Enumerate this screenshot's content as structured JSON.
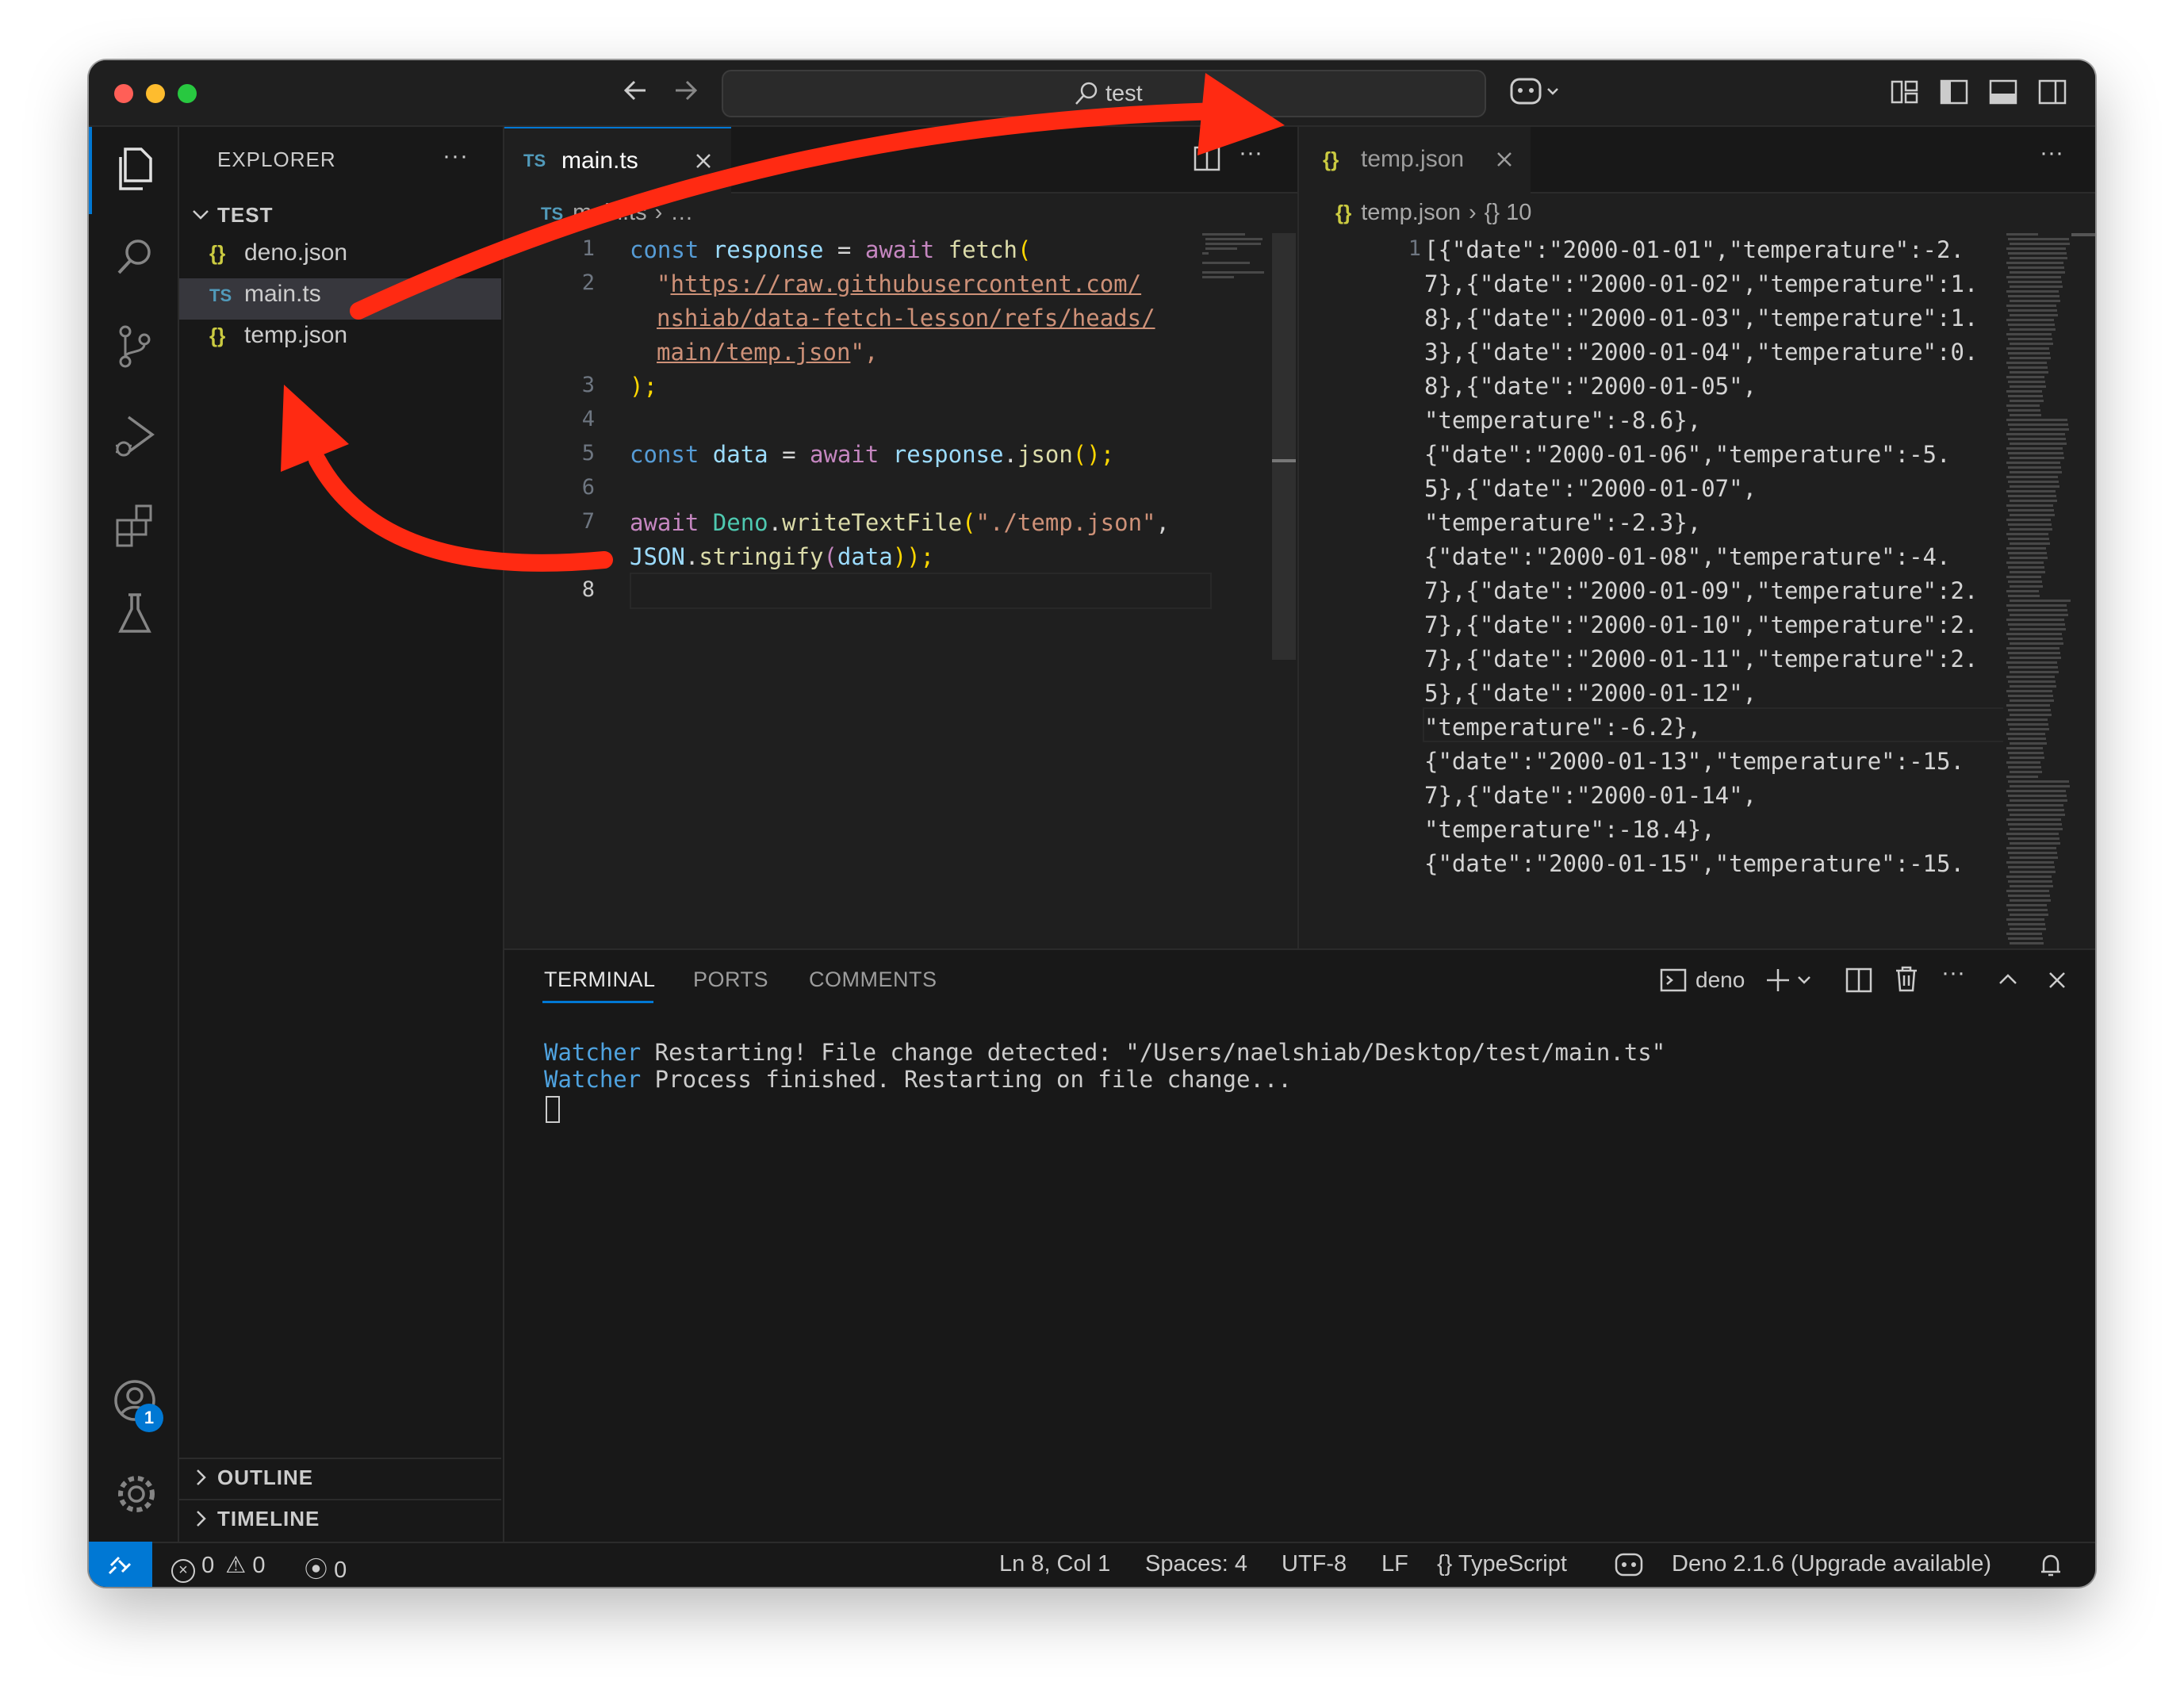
{
  "titlebar": {
    "search_text": "test"
  },
  "sidebar": {
    "title": "EXPLORER",
    "more": "···",
    "folder": "TEST",
    "files": [
      {
        "badge": "{}",
        "name": "deno.json"
      },
      {
        "badge": "TS",
        "name": "main.ts"
      },
      {
        "badge": "{}",
        "name": "temp.json"
      }
    ],
    "outline": "OUTLINE",
    "timeline": "TIMELINE"
  },
  "accounts_badge": "1",
  "editor1": {
    "tab_badge": "TS",
    "tab_label": "main.ts",
    "breadcrumb_badge": "TS",
    "breadcrumb_file": "main.ts",
    "breadcrumb_rest": "…",
    "more": "···",
    "lines": [
      "1",
      "2",
      "3",
      "4",
      "5",
      "6",
      "7",
      "8"
    ],
    "code": {
      "l1_const": "const",
      "l1_var": "response",
      "l1_eq": " = ",
      "l1_await": "await",
      "l1_fn": "fetch",
      "l1_paren": "(",
      "l2_q": "\"",
      "l2_url1": "https://raw.githubusercontent.com/",
      "l2_url2": "nshiab/data-fetch-lesson/refs/heads/",
      "l2_url3": "main/temp.json",
      "l2_end": "\",",
      "l3": ");",
      "l5_const": "const",
      "l5_var": "data",
      "l5_eq": " = ",
      "l5_await": "await",
      "l5_obj": "response",
      "l5_dot": ".",
      "l5_fn": "json",
      "l5_end": "();",
      "l7_await": "await",
      "l7_cls": "Deno",
      "l7_dot": ".",
      "l7_fn": "writeTextFile",
      "l7_open": "(",
      "l7_str": "\"./temp.json\"",
      "l7_comma": ",",
      "l7b_cls": "JSON",
      "l7b_dot": ".",
      "l7b_fn": "stringify",
      "l7b_open": "(",
      "l7b_var": "data",
      "l7b_close": "));"
    }
  },
  "editor2": {
    "tab_badge": "{}",
    "tab_label": "temp.json",
    "breadcrumb_badge": "{}",
    "breadcrumb_file": "temp.json",
    "breadcrumb_rest": "{} 10",
    "more": "···",
    "line_number": "1",
    "json_lines": [
      "[{\"date\":\"2000-01-01\",\"temperature\":-2.",
      "7},{\"date\":\"2000-01-02\",\"temperature\":1.",
      "8},{\"date\":\"2000-01-03\",\"temperature\":1.",
      "3},{\"date\":\"2000-01-04\",\"temperature\":0.",
      "8},{\"date\":\"2000-01-05\",",
      "\"temperature\":-8.6},",
      "{\"date\":\"2000-01-06\",\"temperature\":-5.",
      "5},{\"date\":\"2000-01-07\",",
      "\"temperature\":-2.3},",
      "{\"date\":\"2000-01-08\",\"temperature\":-4.",
      "7},{\"date\":\"2000-01-09\",\"temperature\":2.",
      "7},{\"date\":\"2000-01-10\",\"temperature\":2.",
      "7},{\"date\":\"2000-01-11\",\"temperature\":2.",
      "5},{\"date\":\"2000-01-12\",",
      "\"temperature\":-6.2},",
      "{\"date\":\"2000-01-13\",\"temperature\":-15.",
      "7},{\"date\":\"2000-01-14\",",
      "\"temperature\":-18.4},",
      "{\"date\":\"2000-01-15\",\"temperature\":-15."
    ]
  },
  "panel": {
    "tabs": [
      "TERMINAL",
      "PORTS",
      "COMMENTS"
    ],
    "terminal_name": "deno",
    "more": "···",
    "watcher": "Watcher",
    "line1": " Restarting! File change detected: \"/Users/naelshiab/Desktop/test/main.ts\"",
    "line2": " Process finished. Restarting on file change..."
  },
  "statusbar": {
    "errors": "0",
    "warnings": "0",
    "ports": "0",
    "position": "Ln 8, Col 1",
    "spaces": "Spaces: 4",
    "encoding": "UTF-8",
    "eol": "LF",
    "lang_icon": "{}",
    "language": "TypeScript",
    "deno": "Deno 2.1.6 (Upgrade available)"
  },
  "colors": {
    "accent": "#0078d4",
    "annotation_arrow": "#ff2a12",
    "traffic_red": "#ff5f57",
    "traffic_yellow": "#febc2e",
    "traffic_green": "#28c840"
  }
}
